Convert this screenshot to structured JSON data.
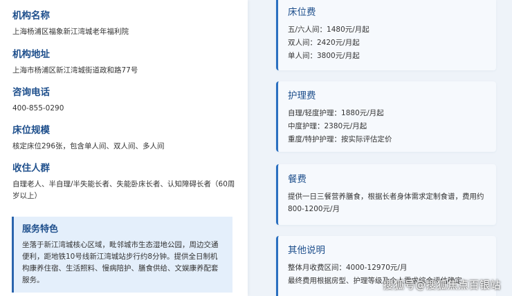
{
  "info": [
    {
      "title": "机构名称",
      "text": "上海杨浦区福象新江湾城老年福利院"
    },
    {
      "title": "机构地址",
      "text": "上海市杨浦区新江湾城街道政和路77号"
    },
    {
      "title": "咨询电话",
      "text": "400-855-0290"
    },
    {
      "title": "床位规模",
      "text": "核定床位296张，包含单人间、双人间、多人间"
    },
    {
      "title": "收住人群",
      "text": "自理老人、半自理/半失能长者、失能卧床长者、认知障碍长者（60周岁以上）"
    }
  ],
  "features": {
    "title": "服务特色",
    "text": "坐落于新江湾城核心区域，毗邻城市生态湿地公园，周边交通便利，距地铁10号线新江湾城站步行约8分钟。提供全日制机构康养住宿、生活照料、慢病陪护、膳食供给、文娱康养配套服务。"
  },
  "fees": [
    {
      "title": "床位费",
      "lines": [
        "五/六人间：1480元/月起",
        "双人间：2420元/月起",
        "单人间：3800元/月起"
      ]
    },
    {
      "title": "护理费",
      "lines": [
        "自理/轻度护理：1880元/月起",
        "中度护理：2380元/月起",
        "重度/特护护理：按实际评估定价"
      ]
    },
    {
      "title": "餐费",
      "lines": [
        "提供一日三餐营养膳食，根据长者身体需求定制食谱，费用约800-1200元/月"
      ]
    },
    {
      "title": "其他说明",
      "lines": [
        "整体月收费区间：4000-12970元/月",
        "最终费用根据房型、护理等级及个人需求综合评估确定"
      ]
    }
  ],
  "watermark": "搜狐号@搜狐焦点百银站",
  "colors": {
    "accent": "#1e4f8c",
    "border": "#2a6fc0",
    "feature_bg": "#e4effb"
  }
}
